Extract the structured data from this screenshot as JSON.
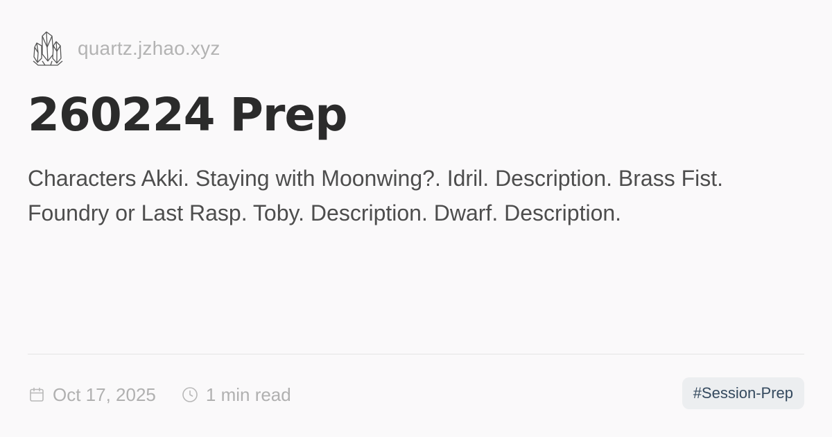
{
  "site": {
    "name": "quartz.jzhao.xyz",
    "logo_icon": "crystal-logo-icon"
  },
  "page": {
    "title": "260224 Prep",
    "description": "Characters Akki. Staying with Moonwing?. Idril. Description. Brass Fist. Foundry or Last Rasp. Toby. Description. Dwarf. Description."
  },
  "meta": {
    "date": "Oct 17, 2025",
    "date_icon": "calendar-icon",
    "reading_time": "1 min read",
    "reading_time_icon": "clock-icon"
  },
  "tags": [
    {
      "label": "#Session-Prep"
    }
  ],
  "colors": {
    "background": "#faf9fa",
    "title": "#2b2b2b",
    "body_text": "#4d4d4d",
    "muted": "#b0b0b0",
    "tag_bg": "#eceef0",
    "tag_text": "#34495e"
  }
}
